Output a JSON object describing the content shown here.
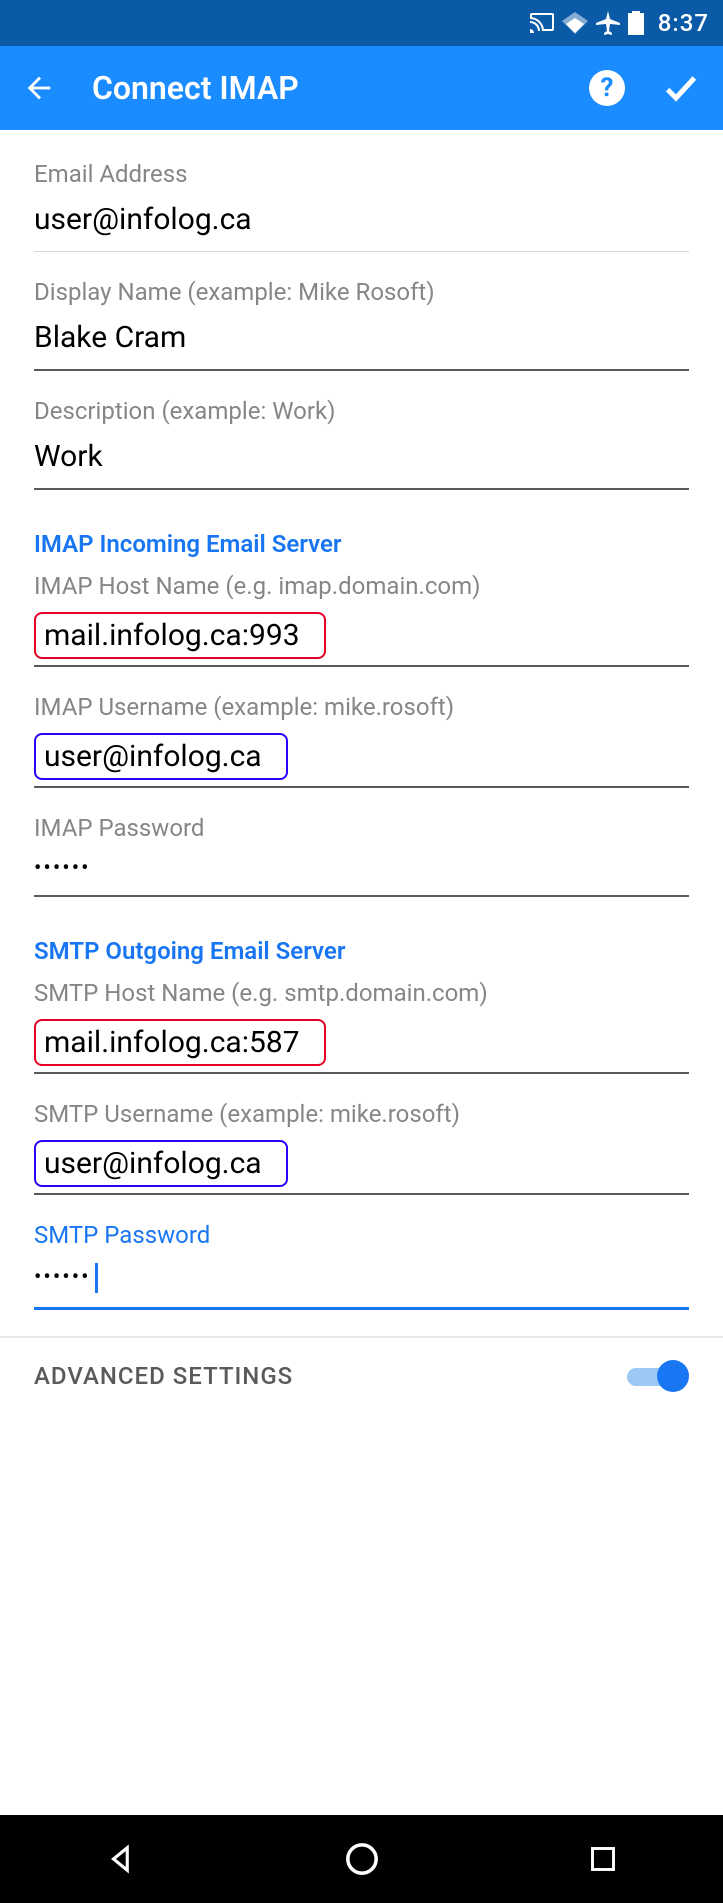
{
  "status_bar": {
    "time": "8:37"
  },
  "app_bar": {
    "title": "Connect IMAP"
  },
  "fields": {
    "email": {
      "label": "Email Address",
      "value": "user@infolog.ca"
    },
    "display_name": {
      "label": "Display Name (example: Mike Rosoft)",
      "value": "Blake Cram"
    },
    "description": {
      "label": "Description (example: Work)",
      "value": "Work"
    }
  },
  "imap": {
    "header": "IMAP Incoming Email Server",
    "host": {
      "label": "IMAP Host Name (e.g. imap.domain.com)",
      "value": "mail.infolog.ca:993"
    },
    "user": {
      "label": "IMAP Username (example: mike.rosoft)",
      "value": "user@infolog.ca"
    },
    "password": {
      "label": "IMAP Password",
      "value": "••••••"
    }
  },
  "smtp": {
    "header": "SMTP Outgoing Email Server",
    "host": {
      "label": "SMTP Host Name (e.g. smtp.domain.com)",
      "value": "mail.infolog.ca:587"
    },
    "user": {
      "label": "SMTP Username (example: mike.rosoft)",
      "value": "user@infolog.ca"
    },
    "password": {
      "label": "SMTP Password",
      "value": "••••••"
    }
  },
  "advanced": {
    "label": "ADVANCED SETTINGS",
    "enabled": true
  }
}
